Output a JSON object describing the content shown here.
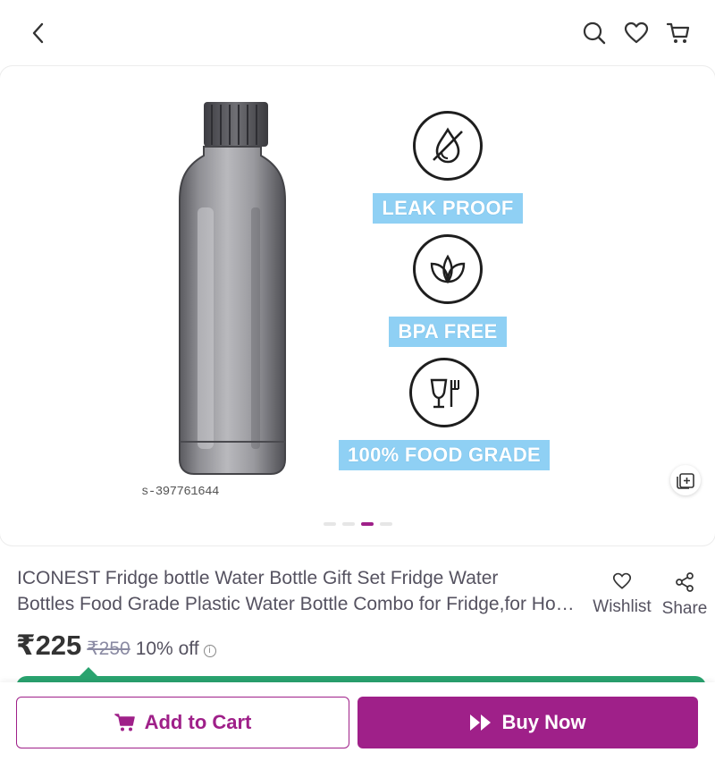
{
  "header": {
    "back_icon": "chevron-left-icon",
    "search_icon": "search-icon",
    "wishlist_icon": "heart-icon",
    "cart_icon": "cart-icon"
  },
  "gallery": {
    "sku_text": "s-397761644",
    "features": [
      {
        "label": "LEAK PROOF",
        "icon": "no-drop-icon"
      },
      {
        "label": "BPA FREE",
        "icon": "leaf-icon"
      },
      {
        "label": "100% FOOD GRADE",
        "icon": "glass-fork-icon"
      }
    ],
    "page_count": 4,
    "active_page": 3
  },
  "product": {
    "title_line1": "ICONEST Fridge bottle Water Bottle Gift Set Fridge Water",
    "title_line2": "Bottles Food Grade Plastic Water Bottle Combo for Fridge,for Home, Office",
    "price": "₹225",
    "mrp": "₹250",
    "discount": "10% off",
    "info_symbol": "i"
  },
  "actions": {
    "wishlist_label": "Wishlist",
    "share_label": "Share"
  },
  "cta": {
    "add_to_cart": "Add to Cart",
    "buy_now": "Buy Now"
  },
  "colors": {
    "brand": "#9f2089",
    "badge_blue": "#8fd0f4",
    "accent_green": "#2aa36f"
  }
}
